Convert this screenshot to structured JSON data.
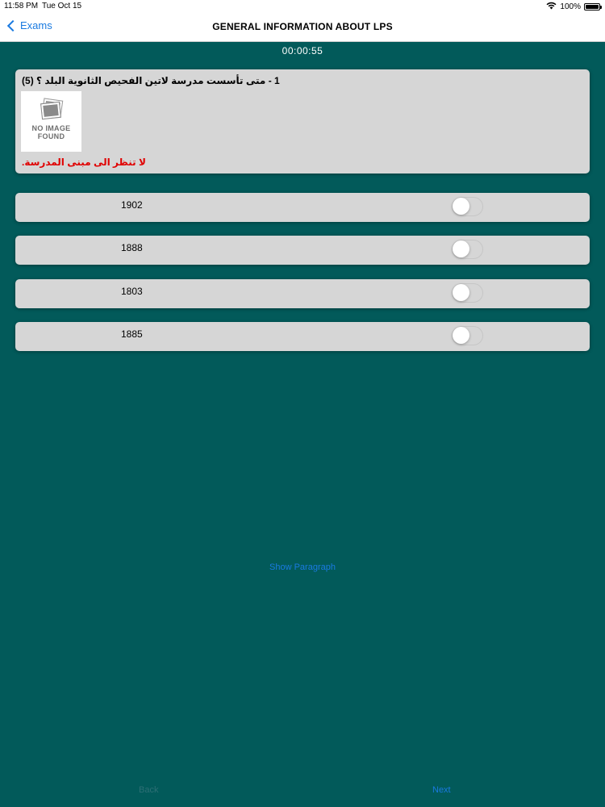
{
  "status_bar": {
    "time": "11:58 PM",
    "date": "Tue Oct 15",
    "battery": "100%",
    "battery_level": 1.0
  },
  "nav": {
    "back_label": "Exams",
    "title": "GENERAL INFORMATION ABOUT LPS"
  },
  "timer": "00:00:55",
  "question": {
    "text": "1 - متى تأسست مدرسة لاتين الفحيص الثانوية البلد ؟  (5)",
    "image_placeholder": "NO IMAGE\nFOUND",
    "hint": "لا تنظر الى مبنى المدرسة."
  },
  "options": [
    {
      "label": "1902",
      "selected": false
    },
    {
      "label": "1888",
      "selected": false
    },
    {
      "label": "1803",
      "selected": false
    },
    {
      "label": "1885",
      "selected": false
    }
  ],
  "show_paragraph_label": "Show Paragraph",
  "footer": {
    "back_label": "Back",
    "next_label": "Next"
  },
  "colors": {
    "background": "#025a5a",
    "card": "#d6d6d6",
    "link": "#1a7ae0",
    "hint": "#e00000"
  }
}
